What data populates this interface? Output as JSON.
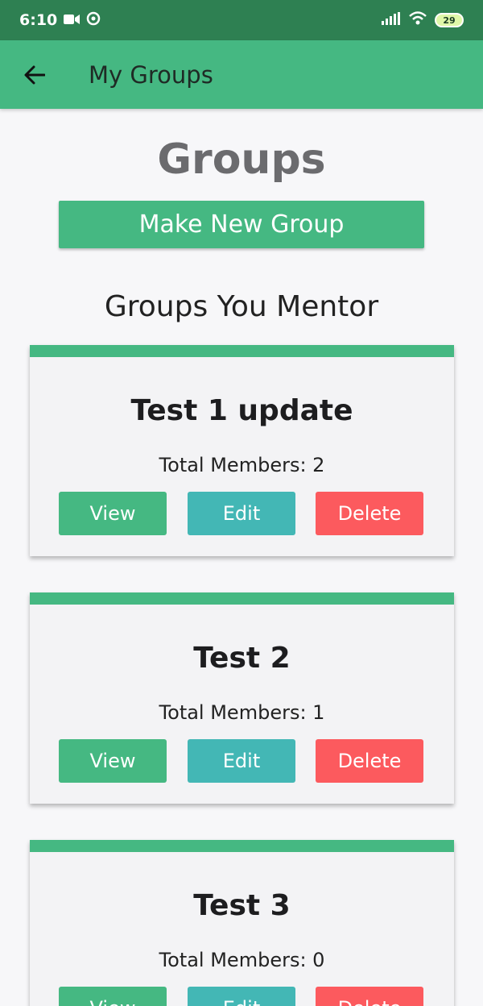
{
  "status_bar": {
    "time": "6:10",
    "battery": "29"
  },
  "app_bar": {
    "title": "My Groups"
  },
  "page": {
    "heading": "Groups",
    "make_button": "Make New Group",
    "section_heading": "Groups You Mentor"
  },
  "groups": [
    {
      "name": "Test  1 update",
      "members": "Total Members: 2",
      "view": "View",
      "edit": "Edit",
      "delete": "Delete"
    },
    {
      "name": "Test 2",
      "members": "Total Members: 1",
      "view": "View",
      "edit": "Edit",
      "delete": "Delete"
    },
    {
      "name": "Test 3",
      "members": "Total Members: 0",
      "view": "View",
      "edit": "Edit",
      "delete": "Delete"
    }
  ],
  "colors": {
    "primary": "#45b882",
    "status_bar": "#2e8052",
    "edit": "#43b7b5",
    "delete": "#fc5a5e"
  }
}
